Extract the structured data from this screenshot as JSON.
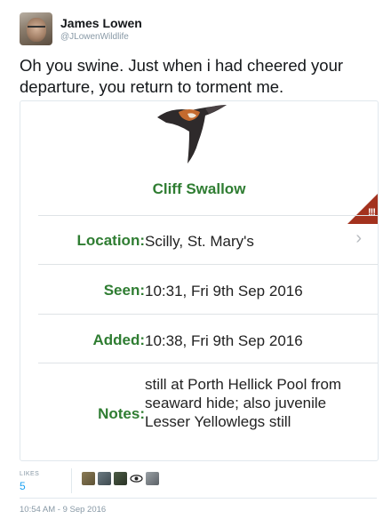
{
  "tweet": {
    "author_name": "James Lowen",
    "author_handle": "@JLowenWildlife",
    "text": "Oh you swine. Just when i had cheered your departure, you return to torment me.",
    "timestamp": "10:54 AM - 9 Sep 2016"
  },
  "card": {
    "species": "Cliff Swallow",
    "rarity_marker": "!!!",
    "rows": [
      {
        "label": "Location:",
        "value": "Scilly, St. Mary's"
      },
      {
        "label": "Seen:",
        "value": "10:31, Fri 9th Sep 2016"
      },
      {
        "label": "Added:",
        "value": "10:38, Fri 9th Sep 2016"
      },
      {
        "label": "Notes:",
        "value": "still at Porth Hellick Pool from seaward hide; also juvenile Lesser Yellowlegs still"
      }
    ],
    "accent_color": "#2f7d32",
    "rarity_color": "#a3321e"
  },
  "stats": {
    "likes_label": "LIKES",
    "likes_count": "5"
  },
  "icons": [
    "chevron-right-icon"
  ]
}
